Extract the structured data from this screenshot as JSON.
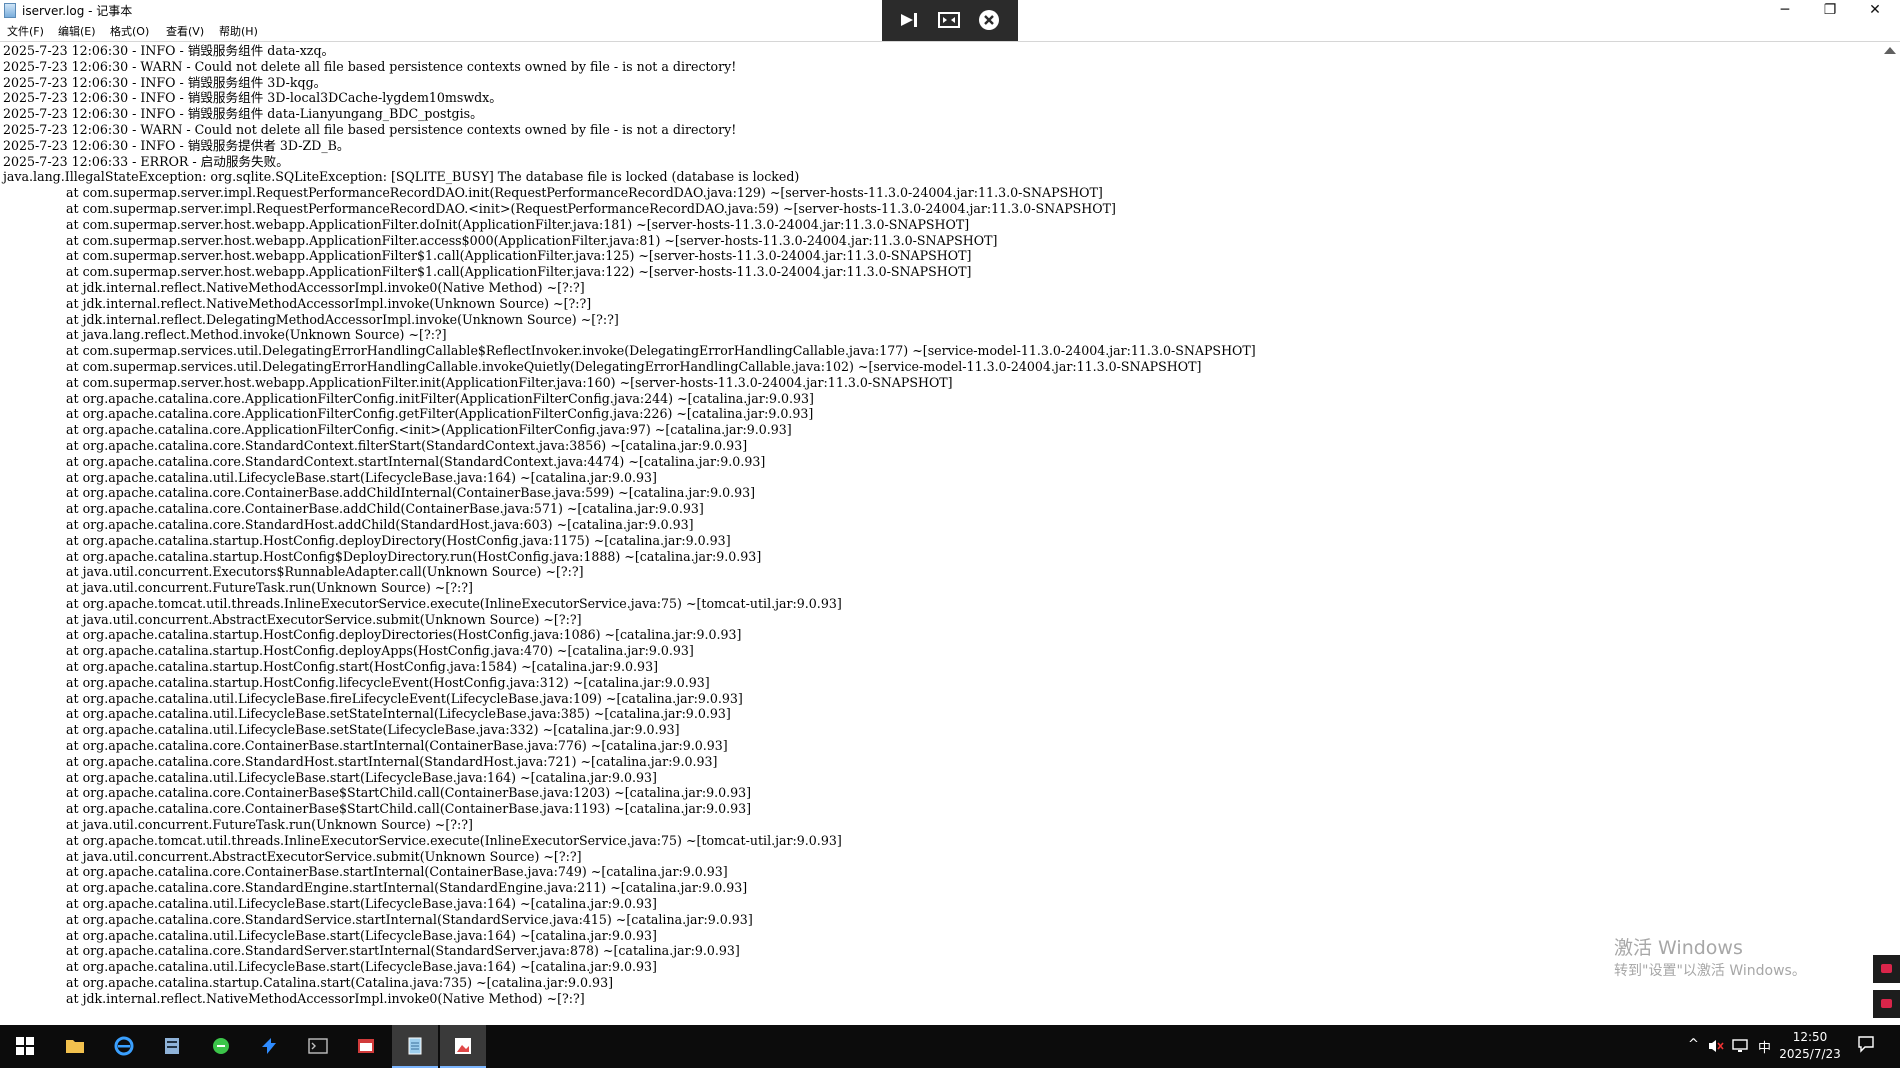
{
  "window": {
    "title": "iserver.log - 记事本",
    "minimize": "─",
    "maximize": "❐",
    "close": "✕"
  },
  "menu": [
    "文件(F)",
    "编辑(E)",
    "格式(O)",
    "查看(V)",
    "帮助(H)"
  ],
  "remote_toolbar": {
    "icons": [
      "pin-icon",
      "resize-icon",
      "close-circle-icon"
    ]
  },
  "log_lines": [
    {
      "text": "2025-7-23 12:06:30 - INFO - 销毁服务组件 data-xzq。",
      "indent": false
    },
    {
      "text": "2025-7-23 12:06:30 - WARN - Could not delete all file based persistence contexts owned by file - is not a directory!",
      "indent": false
    },
    {
      "text": "2025-7-23 12:06:30 - INFO - 销毁服务组件 3D-kqg。",
      "indent": false
    },
    {
      "text": "2025-7-23 12:06:30 - INFO - 销毁服务组件 3D-local3DCache-lygdem10mswdx。",
      "indent": false
    },
    {
      "text": "2025-7-23 12:06:30 - INFO - 销毁服务组件 data-Lianyungang_BDC_postgis。",
      "indent": false
    },
    {
      "text": "2025-7-23 12:06:30 - WARN - Could not delete all file based persistence contexts owned by file - is not a directory!",
      "indent": false
    },
    {
      "text": "2025-7-23 12:06:30 - INFO - 销毁服务提供者 3D-ZD_B。",
      "indent": false
    },
    {
      "text": "2025-7-23 12:06:33 - ERROR - 启动服务失败。",
      "indent": false
    },
    {
      "text": "java.lang.IllegalStateException: org.sqlite.SQLiteException: [SQLITE_BUSY] The database file is locked (database is locked)",
      "indent": false
    },
    {
      "text": "at com.supermap.server.impl.RequestPerformanceRecordDAO.init(RequestPerformanceRecordDAO.java:129) ~[server-hosts-11.3.0-24004.jar:11.3.0-SNAPSHOT]",
      "indent": true
    },
    {
      "text": "at com.supermap.server.impl.RequestPerformanceRecordDAO.<init>(RequestPerformanceRecordDAO.java:59) ~[server-hosts-11.3.0-24004.jar:11.3.0-SNAPSHOT]",
      "indent": true
    },
    {
      "text": "at com.supermap.server.host.webapp.ApplicationFilter.doInit(ApplicationFilter.java:181) ~[server-hosts-11.3.0-24004.jar:11.3.0-SNAPSHOT]",
      "indent": true
    },
    {
      "text": "at com.supermap.server.host.webapp.ApplicationFilter.access$000(ApplicationFilter.java:81) ~[server-hosts-11.3.0-24004.jar:11.3.0-SNAPSHOT]",
      "indent": true
    },
    {
      "text": "at com.supermap.server.host.webapp.ApplicationFilter$1.call(ApplicationFilter.java:125) ~[server-hosts-11.3.0-24004.jar:11.3.0-SNAPSHOT]",
      "indent": true
    },
    {
      "text": "at com.supermap.server.host.webapp.ApplicationFilter$1.call(ApplicationFilter.java:122) ~[server-hosts-11.3.0-24004.jar:11.3.0-SNAPSHOT]",
      "indent": true
    },
    {
      "text": "at jdk.internal.reflect.NativeMethodAccessorImpl.invoke0(Native Method) ~[?:?]",
      "indent": true
    },
    {
      "text": "at jdk.internal.reflect.NativeMethodAccessorImpl.invoke(Unknown Source) ~[?:?]",
      "indent": true
    },
    {
      "text": "at jdk.internal.reflect.DelegatingMethodAccessorImpl.invoke(Unknown Source) ~[?:?]",
      "indent": true
    },
    {
      "text": "at java.lang.reflect.Method.invoke(Unknown Source) ~[?:?]",
      "indent": true
    },
    {
      "text": "at com.supermap.services.util.DelegatingErrorHandlingCallable$ReflectInvoker.invoke(DelegatingErrorHandlingCallable.java:177) ~[service-model-11.3.0-24004.jar:11.3.0-SNAPSHOT]",
      "indent": true
    },
    {
      "text": "at com.supermap.services.util.DelegatingErrorHandlingCallable.invokeQuietly(DelegatingErrorHandlingCallable.java:102) ~[service-model-11.3.0-24004.jar:11.3.0-SNAPSHOT]",
      "indent": true
    },
    {
      "text": "at com.supermap.server.host.webapp.ApplicationFilter.init(ApplicationFilter.java:160) ~[server-hosts-11.3.0-24004.jar:11.3.0-SNAPSHOT]",
      "indent": true
    },
    {
      "text": "at org.apache.catalina.core.ApplicationFilterConfig.initFilter(ApplicationFilterConfig.java:244) ~[catalina.jar:9.0.93]",
      "indent": true
    },
    {
      "text": "at org.apache.catalina.core.ApplicationFilterConfig.getFilter(ApplicationFilterConfig.java:226) ~[catalina.jar:9.0.93]",
      "indent": true
    },
    {
      "text": "at org.apache.catalina.core.ApplicationFilterConfig.<init>(ApplicationFilterConfig.java:97) ~[catalina.jar:9.0.93]",
      "indent": true
    },
    {
      "text": "at org.apache.catalina.core.StandardContext.filterStart(StandardContext.java:3856) ~[catalina.jar:9.0.93]",
      "indent": true
    },
    {
      "text": "at org.apache.catalina.core.StandardContext.startInternal(StandardContext.java:4474) ~[catalina.jar:9.0.93]",
      "indent": true
    },
    {
      "text": "at org.apache.catalina.util.LifecycleBase.start(LifecycleBase.java:164) ~[catalina.jar:9.0.93]",
      "indent": true
    },
    {
      "text": "at org.apache.catalina.core.ContainerBase.addChildInternal(ContainerBase.java:599) ~[catalina.jar:9.0.93]",
      "indent": true
    },
    {
      "text": "at org.apache.catalina.core.ContainerBase.addChild(ContainerBase.java:571) ~[catalina.jar:9.0.93]",
      "indent": true
    },
    {
      "text": "at org.apache.catalina.core.StandardHost.addChild(StandardHost.java:603) ~[catalina.jar:9.0.93]",
      "indent": true
    },
    {
      "text": "at org.apache.catalina.startup.HostConfig.deployDirectory(HostConfig.java:1175) ~[catalina.jar:9.0.93]",
      "indent": true
    },
    {
      "text": "at org.apache.catalina.startup.HostConfig$DeployDirectory.run(HostConfig.java:1888) ~[catalina.jar:9.0.93]",
      "indent": true
    },
    {
      "text": "at java.util.concurrent.Executors$RunnableAdapter.call(Unknown Source) ~[?:?]",
      "indent": true
    },
    {
      "text": "at java.util.concurrent.FutureTask.run(Unknown Source) ~[?:?]",
      "indent": true
    },
    {
      "text": "at org.apache.tomcat.util.threads.InlineExecutorService.execute(InlineExecutorService.java:75) ~[tomcat-util.jar:9.0.93]",
      "indent": true
    },
    {
      "text": "at java.util.concurrent.AbstractExecutorService.submit(Unknown Source) ~[?:?]",
      "indent": true
    },
    {
      "text": "at org.apache.catalina.startup.HostConfig.deployDirectories(HostConfig.java:1086) ~[catalina.jar:9.0.93]",
      "indent": true
    },
    {
      "text": "at org.apache.catalina.startup.HostConfig.deployApps(HostConfig.java:470) ~[catalina.jar:9.0.93]",
      "indent": true
    },
    {
      "text": "at org.apache.catalina.startup.HostConfig.start(HostConfig.java:1584) ~[catalina.jar:9.0.93]",
      "indent": true
    },
    {
      "text": "at org.apache.catalina.startup.HostConfig.lifecycleEvent(HostConfig.java:312) ~[catalina.jar:9.0.93]",
      "indent": true
    },
    {
      "text": "at org.apache.catalina.util.LifecycleBase.fireLifecycleEvent(LifecycleBase.java:109) ~[catalina.jar:9.0.93]",
      "indent": true
    },
    {
      "text": "at org.apache.catalina.util.LifecycleBase.setStateInternal(LifecycleBase.java:385) ~[catalina.jar:9.0.93]",
      "indent": true
    },
    {
      "text": "at org.apache.catalina.util.LifecycleBase.setState(LifecycleBase.java:332) ~[catalina.jar:9.0.93]",
      "indent": true
    },
    {
      "text": "at org.apache.catalina.core.ContainerBase.startInternal(ContainerBase.java:776) ~[catalina.jar:9.0.93]",
      "indent": true
    },
    {
      "text": "at org.apache.catalina.core.StandardHost.startInternal(StandardHost.java:721) ~[catalina.jar:9.0.93]",
      "indent": true
    },
    {
      "text": "at org.apache.catalina.util.LifecycleBase.start(LifecycleBase.java:164) ~[catalina.jar:9.0.93]",
      "indent": true
    },
    {
      "text": "at org.apache.catalina.core.ContainerBase$StartChild.call(ContainerBase.java:1203) ~[catalina.jar:9.0.93]",
      "indent": true
    },
    {
      "text": "at org.apache.catalina.core.ContainerBase$StartChild.call(ContainerBase.java:1193) ~[catalina.jar:9.0.93]",
      "indent": true
    },
    {
      "text": "at java.util.concurrent.FutureTask.run(Unknown Source) ~[?:?]",
      "indent": true
    },
    {
      "text": "at org.apache.tomcat.util.threads.InlineExecutorService.execute(InlineExecutorService.java:75) ~[tomcat-util.jar:9.0.93]",
      "indent": true
    },
    {
      "text": "at java.util.concurrent.AbstractExecutorService.submit(Unknown Source) ~[?:?]",
      "indent": true
    },
    {
      "text": "at org.apache.catalina.core.ContainerBase.startInternal(ContainerBase.java:749) ~[catalina.jar:9.0.93]",
      "indent": true
    },
    {
      "text": "at org.apache.catalina.core.StandardEngine.startInternal(StandardEngine.java:211) ~[catalina.jar:9.0.93]",
      "indent": true
    },
    {
      "text": "at org.apache.catalina.util.LifecycleBase.start(LifecycleBase.java:164) ~[catalina.jar:9.0.93]",
      "indent": true
    },
    {
      "text": "at org.apache.catalina.core.StandardService.startInternal(StandardService.java:415) ~[catalina.jar:9.0.93]",
      "indent": true
    },
    {
      "text": "at org.apache.catalina.util.LifecycleBase.start(LifecycleBase.java:164) ~[catalina.jar:9.0.93]",
      "indent": true
    },
    {
      "text": "at org.apache.catalina.core.StandardServer.startInternal(StandardServer.java:878) ~[catalina.jar:9.0.93]",
      "indent": true
    },
    {
      "text": "at org.apache.catalina.util.LifecycleBase.start(LifecycleBase.java:164) ~[catalina.jar:9.0.93]",
      "indent": true
    },
    {
      "text": "at org.apache.catalina.startup.Catalina.start(Catalina.java:735) ~[catalina.jar:9.0.93]",
      "indent": true
    },
    {
      "text": "at jdk.internal.reflect.NativeMethodAccessorImpl.invoke0(Native Method) ~[?:?]",
      "indent": true
    }
  ],
  "watermark": {
    "title": "激活 Windows",
    "subtitle": "转到\"设置\"以激活 Windows。"
  },
  "taskbar": {
    "apps": [
      {
        "name": "start-button",
        "icon": "windows-logo-icon",
        "color": "#ffffff",
        "active": false
      },
      {
        "name": "taskbar-file-explorer",
        "icon": "folder-icon",
        "color": "#f2c14e",
        "active": false
      },
      {
        "name": "taskbar-internet-explorer",
        "icon": "ie-icon",
        "color": "#3aa0ff",
        "active": false
      },
      {
        "name": "taskbar-server-manager",
        "icon": "server-icon",
        "color": "#8fb3d9",
        "active": false
      },
      {
        "name": "taskbar-green-app",
        "icon": "green-circle-icon",
        "color": "#3cc54a",
        "active": false
      },
      {
        "name": "taskbar-arrow-app",
        "icon": "blue-arrow-icon",
        "color": "#2f8cff",
        "active": false
      },
      {
        "name": "taskbar-command-prompt",
        "icon": "terminal-icon",
        "color": "#c0c0c0",
        "active": false
      },
      {
        "name": "taskbar-red-window-app",
        "icon": "red-window-icon",
        "color": "#d13b3b",
        "active": false
      },
      {
        "name": "taskbar-notepad",
        "icon": "notepad-icon",
        "color": "#9ecfee",
        "active": true
      },
      {
        "name": "taskbar-photo-app",
        "icon": "image-app-icon",
        "color": "#e04848",
        "active": true
      }
    ],
    "tray": {
      "chevron": "^",
      "ime": "中",
      "time": "12:50",
      "date": "2025/7/23"
    }
  }
}
